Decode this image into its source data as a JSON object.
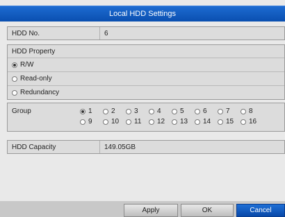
{
  "window": {
    "title": "Local HDD Settings"
  },
  "hdd": {
    "label": "HDD No.",
    "value": "6"
  },
  "property": {
    "heading": "HDD Property",
    "options": [
      {
        "label": "R/W",
        "selected": true
      },
      {
        "label": "Read-only",
        "selected": false
      },
      {
        "label": "Redundancy",
        "selected": false
      }
    ]
  },
  "group": {
    "label": "Group",
    "options": [
      "1",
      "2",
      "3",
      "4",
      "5",
      "6",
      "7",
      "8",
      "9",
      "10",
      "11",
      "12",
      "13",
      "14",
      "15",
      "16"
    ],
    "selected": "1"
  },
  "capacity": {
    "label": "HDD Capacity",
    "value": "149.05GB"
  },
  "buttons": {
    "apply": "Apply",
    "ok": "OK",
    "cancel": "Cancel"
  },
  "colors": {
    "title_bar": "#0a4fb0",
    "primary_button": "#0848a8"
  }
}
